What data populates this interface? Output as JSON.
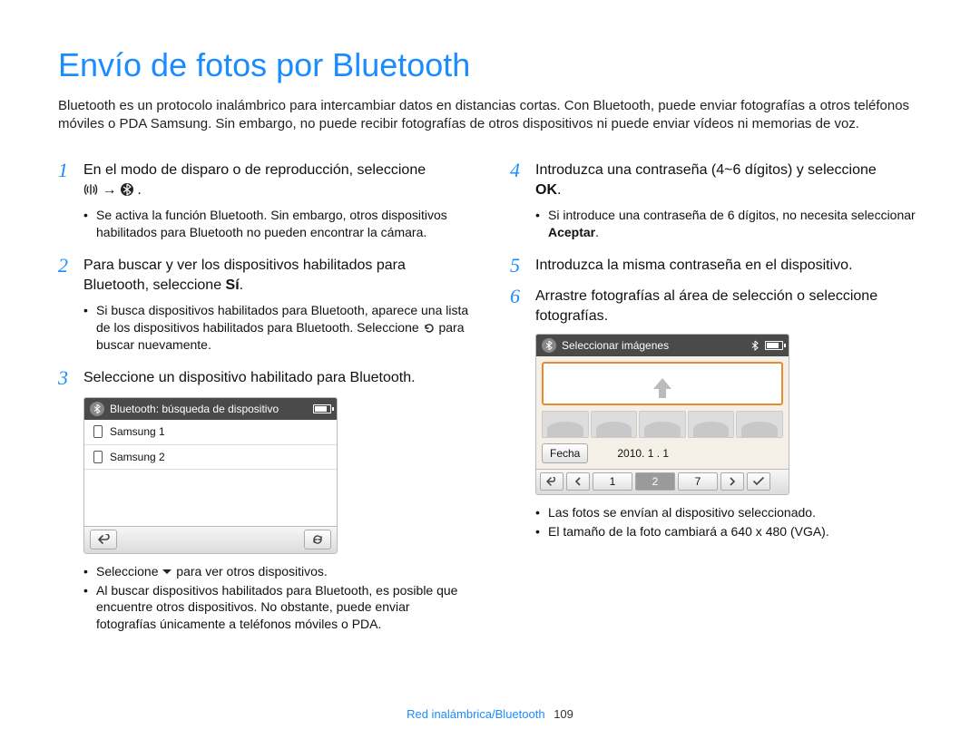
{
  "title": "Envío de fotos por Bluetooth",
  "intro": "Bluetooth es un protocolo inalámbrico para intercambiar datos en distancias cortas. Con Bluetooth, puede enviar fotografías a otros teléfonos móviles o PDA Samsung. Sin embargo, no puede recibir fotografías de otros dispositivos ni puede enviar vídeos ni memorias de voz.",
  "steps": {
    "s1": {
      "num": "1",
      "text_a": "En el modo de disparo o de reproducción, seleccione",
      "text_b": " → ",
      "text_c": ".",
      "bullets": [
        "Se activa la función Bluetooth. Sin embargo, otros dispositivos habilitados para Bluetooth no pueden encontrar la cámara."
      ]
    },
    "s2": {
      "num": "2",
      "text_a": "Para buscar y ver los dispositivos habilitados para Bluetooth, seleccione ",
      "bold": "Sí",
      "text_b": ".",
      "bullets_a": "Si busca dispositivos habilitados para Bluetooth, aparece una lista de los dispositivos habilitados para Bluetooth. Seleccione ",
      "bullets_b": " para buscar nuevamente."
    },
    "s3": {
      "num": "3",
      "text": "Seleccione un dispositivo habilitado para Bluetooth.",
      "screen": {
        "title": "Bluetooth: búsqueda de dispositivo",
        "items": [
          "Samsung 1",
          "Samsung 2"
        ]
      },
      "bullets_a_pre": "Seleccione ",
      "bullets_a_post": " para ver otros dispositivos.",
      "bullets_b": "Al buscar dispositivos habilitados para Bluetooth, es posible que encuentre otros dispositivos. No obstante, puede enviar fotografías únicamente a teléfonos móviles o PDA."
    },
    "s4": {
      "num": "4",
      "text_a": "Introduzca una contraseña (4~6 dígitos) y seleccione ",
      "bold": "OK",
      "text_b": ".",
      "bullets_a": "Si introduce una contraseña de 6 dígitos, no necesita seleccionar ",
      "bullets_bold": "Aceptar",
      "bullets_b": "."
    },
    "s5": {
      "num": "5",
      "text": "Introduzca la misma contraseña en el dispositivo."
    },
    "s6": {
      "num": "6",
      "text": "Arrastre fotografías al área de selección o seleccione fotografías.",
      "screen": {
        "title": "Seleccionar imágenes",
        "fecha_label": "Fecha",
        "date": "2010. 1 . 1",
        "pager": [
          "1",
          "2",
          "7"
        ]
      },
      "bullets": [
        "Las fotos se envían al dispositivo seleccionado.",
        "El tamaño de la foto cambiará a 640 x 480 (VGA)."
      ]
    }
  },
  "footer": {
    "section": "Red inalámbrica/Bluetooth",
    "page": "109"
  }
}
